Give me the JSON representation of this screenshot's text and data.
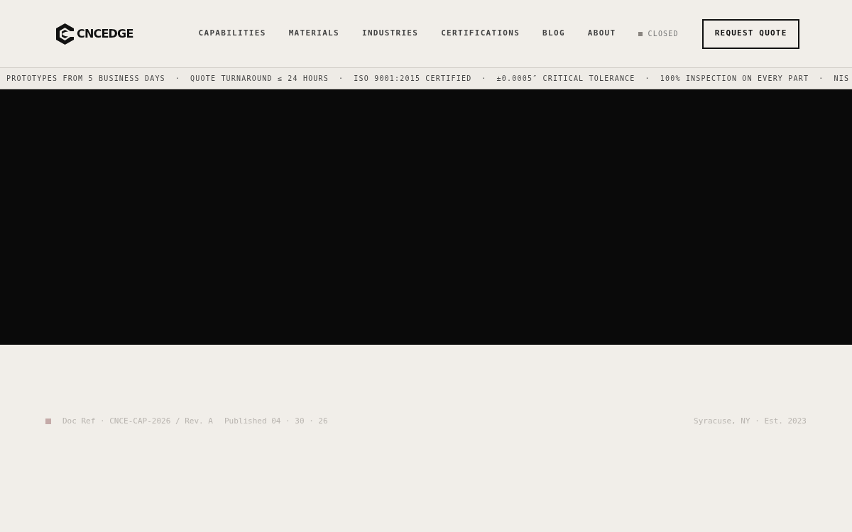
{
  "logo": {
    "text": "CNCEDGE"
  },
  "nav": {
    "items": [
      {
        "label": "CAPABILITIES"
      },
      {
        "label": "MATERIALS"
      },
      {
        "label": "INDUSTRIES"
      },
      {
        "label": "CERTIFICATIONS"
      },
      {
        "label": "BLOG"
      },
      {
        "label": "ABOUT"
      }
    ]
  },
  "status": {
    "label": "CLOSED"
  },
  "cta": {
    "label": "REQUEST QUOTE"
  },
  "ticker": {
    "items": [
      "PROTOTYPES FROM 5 BUSINESS DAYS",
      "QUOTE TURNAROUND ≤ 24 HOURS",
      "ISO 9001:2015 CERTIFIED",
      "±0.0005″ CRITICAL TOLERANCE",
      "100% INSPECTION ON EVERY PART",
      "NIS"
    ],
    "separator": "·"
  },
  "footer": {
    "doc_ref": "Doc Ref · CNCE-CAP-2026 / Rev. A",
    "published": "Published 04 · 30 · 26",
    "location": "Syracuse, NY · Est. 2023"
  }
}
